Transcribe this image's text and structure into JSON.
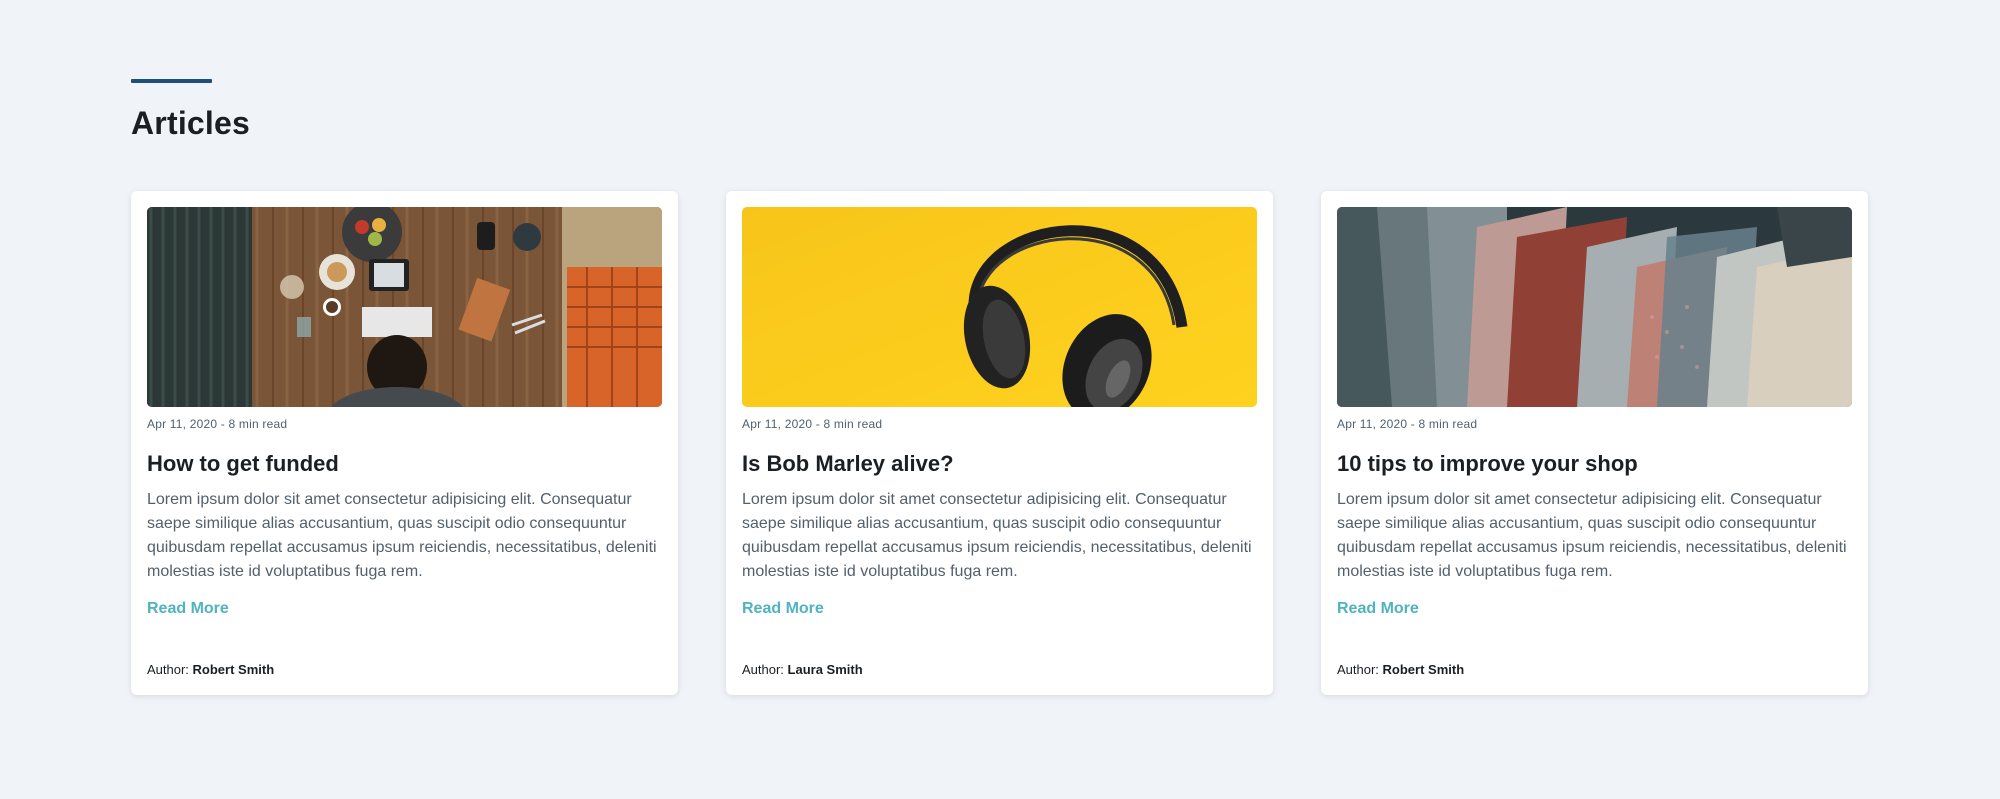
{
  "section": {
    "title": "Articles"
  },
  "colors": {
    "accent": "#4fb3c0",
    "title_bar": "#1f4e79",
    "background": "#f0f4f8"
  },
  "articles": [
    {
      "image": "desk-workspace-photo",
      "meta": "Apr 11, 2020 - 8 min read",
      "title": "How to get funded",
      "text": "Lorem ipsum dolor sit amet consectetur adipisicing elit. Consequatur saepe similique alias accusantium, quas suscipit odio consequuntur quibusdam repellat accusamus ipsum reiciendis, necessitatibus, deleniti molestias iste id voluptatibus fuga rem.",
      "read_more": "Read More",
      "author_label": "Author:",
      "author_name": "Robert Smith"
    },
    {
      "image": "headphones-yellow-photo",
      "meta": "Apr 11, 2020 - 8 min read",
      "title": "Is Bob Marley alive?",
      "text": "Lorem ipsum dolor sit amet consectetur adipisicing elit. Consequatur saepe similique alias accusantium, quas suscipit odio consequuntur quibusdam repellat accusamus ipsum reiciendis, necessitatibus, deleniti molestias iste id voluptatibus fuga rem.",
      "read_more": "Read More",
      "author_label": "Author:",
      "author_name": "Laura Smith"
    },
    {
      "image": "clothing-rack-photo",
      "meta": "Apr 11, 2020 - 8 min read",
      "title": "10 tips to improve your shop",
      "text": "Lorem ipsum dolor sit amet consectetur adipisicing elit. Consequatur saepe similique alias accusantium, quas suscipit odio consequuntur quibusdam repellat accusamus ipsum reiciendis, necessitatibus, deleniti molestias iste id voluptatibus fuga rem.",
      "read_more": "Read More",
      "author_label": "Author:",
      "author_name": "Robert Smith"
    }
  ]
}
